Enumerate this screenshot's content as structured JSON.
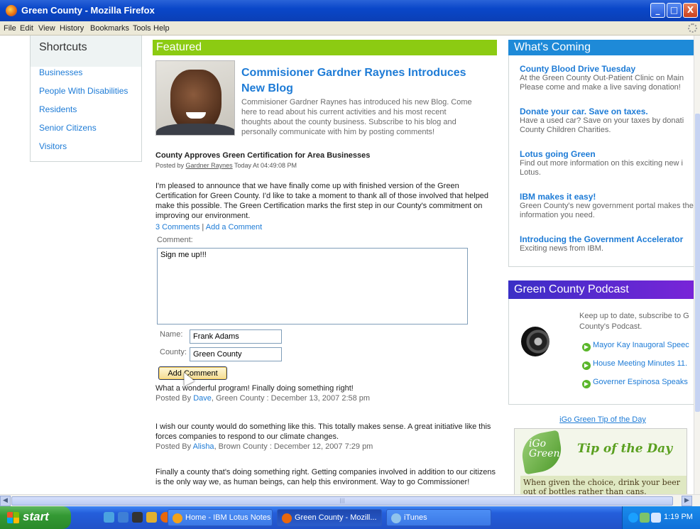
{
  "window": {
    "title": "Green County - Mozilla Firefox",
    "minimize": "_",
    "maximize": "□",
    "close": "X"
  },
  "menu": [
    "File",
    "Edit",
    "View",
    "History",
    "Bookmarks",
    "Tools",
    "Help"
  ],
  "shortcuts": {
    "title": "Shortcuts",
    "items": [
      "Businesses",
      "People With Disabilities",
      "Residents",
      "Senior Citizens",
      "Visitors"
    ]
  },
  "featured": {
    "header": "Featured",
    "title": "Commisioner Gardner Raynes Introduces New Blog",
    "intro": "Commisioner Gardner Raynes has introduced his new Blog. Come here to read about his current activities and his most recent thoughts about the county business. Subscribe to his blog and personally communicate with him by posting comments!",
    "post_title": "County Approves Green Certification for Area Businesses",
    "posted_prefix": "Posted by",
    "posted_author": "Gardner Raynes",
    "posted_suffix": "Today At 04:49:08 PM",
    "body": "I'm pleased to announce that we have finally come up with finished version of the Green Certification for Green County.  I'd like to take a moment to thank all of those involved that helped make this possible.  The Green Certification marks the first step in our County's commitment on improving our environment.",
    "comments_link": "3 Comments",
    "separator": "|",
    "add_comment_link": "Add a Comment",
    "comment_label": "Comment:",
    "comment_value": "Sign me up!!!",
    "name_label": "Name:",
    "name_value": "Frank Adams",
    "county_label": "County:",
    "county_value": "Green County",
    "add_button": "Add Comment",
    "comments": [
      {
        "text": "What a wonderful program! Finally doing something right!",
        "prefix": "Posted By",
        "author": "Dave",
        "meta": ", Green County : December 13, 2007 2:58 pm"
      },
      {
        "text": "I wish our county would do something like this. This totally makes sense. A great initiative like this forces companies to respond to our climate changes.",
        "prefix": "Posted By",
        "author": "Alisha",
        "meta": ", Brown County : December 12, 2007 7:29 pm"
      },
      {
        "text": "Finally a county that's doing something right. Getting companies involved in addition to our citizens is the only way we, as human beings, can help this environment. Way to go Commissioner!",
        "prefix": "",
        "author": "",
        "meta": ""
      }
    ]
  },
  "coming": {
    "header": "What's Coming",
    "items": [
      {
        "title": "County Blood Drive Tuesday",
        "desc": "At the Green County Out-Patient Clinic on Main Please come and make a live saving donation!"
      },
      {
        "title": "Donate your car. Save on taxes.",
        "desc": "Have a used car?  Save on your taxes by donati County Children Charities."
      },
      {
        "title": "Lotus going Green",
        "desc": "Find out more information on this exciting new i Lotus."
      },
      {
        "title": "IBM makes it easy!",
        "desc": "Green County's new government portal makes the information you need."
      },
      {
        "title": "Introducing the Government Accelerator",
        "desc": "Exciting news from IBM."
      }
    ]
  },
  "podcast": {
    "header": "Green County Podcast",
    "intro_line1": "Keep up to date, subscribe to G",
    "intro_line2": "County's Podcast.",
    "links": [
      "Mayor Kay Inaugoral Speec",
      "House Meeting Minutes 11.",
      "Governer Espinosa Speaks"
    ]
  },
  "tip": {
    "link": "iGo Green Tip of the Day",
    "logo_igo": "iGo",
    "logo_green": "Green",
    "logo_tip": "Tip of the Day",
    "note": "When given the choice, drink your beer out of bottles rather than cans."
  },
  "taskbar": {
    "start": "start",
    "tasks": [
      "Home - IBM Lotus Notes",
      "Green County - Mozill...",
      "iTunes"
    ],
    "clock": "1:19 PM"
  },
  "colors": {
    "featured_bar": "#8ccb12",
    "coming_bar": "#1e8ad8",
    "podcast_bar": "#5a28d0",
    "link": "#1d7bd6"
  }
}
